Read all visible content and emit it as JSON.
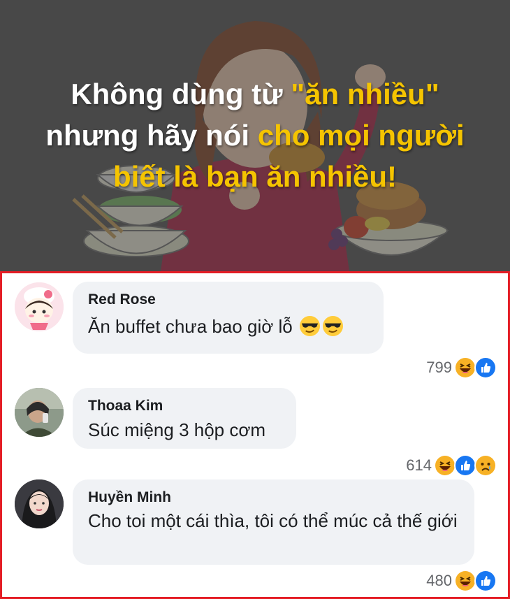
{
  "banner": {
    "headline_lines": [
      {
        "white_a": "Không dùng từ ",
        "yellow": "\"ăn nhiều\"",
        "white_b": ""
      },
      {
        "white_a": "nhưng hãy nói ",
        "yellow": "cho mọi người",
        "white_b": ""
      },
      {
        "white_a": "",
        "yellow": "biết là bạn ăn nhiều!",
        "white_b": ""
      }
    ],
    "highlight_color": "#f5c400",
    "background_color": "#5a5a5a"
  },
  "comments": [
    {
      "author": "Red Rose",
      "text": "Ăn buffet chưa bao giờ lỗ",
      "emoji": [
        "sunglasses-emoji",
        "sunglasses-emoji"
      ],
      "reaction_count": "799",
      "reactions": [
        "haha-reaction",
        "like-reaction"
      ]
    },
    {
      "author": "Thoaa Kim",
      "text": "Súc miệng 3 hộp cơm",
      "emoji": [],
      "reaction_count": "614",
      "reactions": [
        "haha-reaction",
        "like-reaction",
        "sad-reaction"
      ]
    },
    {
      "author": "Huyền Minh",
      "text": "Cho toi một cái thìa, tôi có thể múc cả thế giới",
      "emoji": [],
      "reaction_count": "480",
      "reactions": [
        "haha-reaction",
        "like-reaction"
      ]
    }
  ],
  "colors": {
    "frame": "#e41e26",
    "bubble": "#f0f2f5",
    "like": "#1877f2",
    "haha": "#f7b125"
  }
}
